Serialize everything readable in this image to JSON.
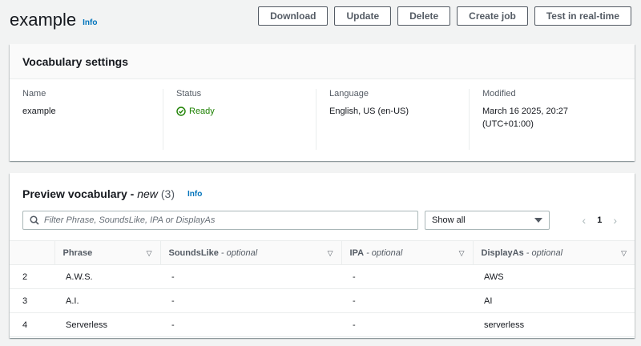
{
  "header": {
    "title": "example",
    "info": "Info"
  },
  "actions": [
    "Download",
    "Update",
    "Delete",
    "Create job",
    "Test in real-time"
  ],
  "settings": {
    "title": "Vocabulary settings",
    "fields": [
      {
        "label": "Name",
        "value": "example"
      },
      {
        "label": "Status",
        "value": "Ready"
      },
      {
        "label": "Language",
        "value": "English, US (en-US)"
      },
      {
        "label": "Modified",
        "value": "March 16 2025, 20:27 (UTC+01:00)"
      }
    ]
  },
  "preview": {
    "title": "Preview vocabulary - ",
    "title_em": "new",
    "count": "(3)",
    "info": "Info",
    "filter_placeholder": "Filter Phrase, SoundsLike, IPA or DisplayAs",
    "select_value": "Show all",
    "page": "1",
    "columns": [
      {
        "name": "",
        "opt": ""
      },
      {
        "name": "Phrase",
        "opt": ""
      },
      {
        "name": "SoundsLike",
        "opt": " - optional"
      },
      {
        "name": "IPA",
        "opt": " - optional"
      },
      {
        "name": "DisplayAs",
        "opt": " - optional"
      }
    ],
    "rows": [
      [
        "2",
        "A.W.S.",
        "-",
        "-",
        "AWS"
      ],
      [
        "3",
        "A.I.",
        "-",
        "-",
        "AI"
      ],
      [
        "4",
        "Serverless",
        "-",
        "-",
        "serverless"
      ]
    ]
  },
  "colors": {
    "accent": "#0073bb",
    "success": "#1d8102"
  }
}
